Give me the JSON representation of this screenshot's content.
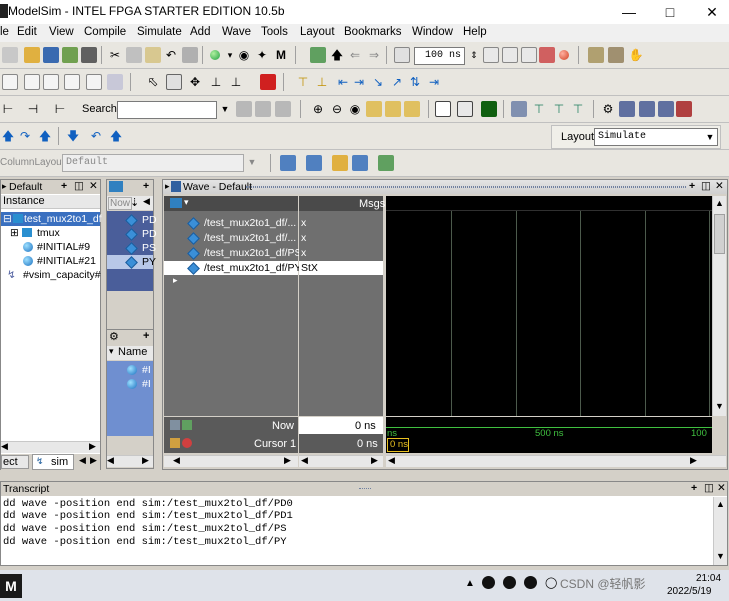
{
  "window": {
    "title": "ModelSim - INTEL FPGA STARTER EDITION 10.5b"
  },
  "menubar": [
    "le",
    "Edit",
    "View",
    "Compile",
    "Simulate",
    "Add",
    "Wave",
    "Tools",
    "Layout",
    "Bookmarks",
    "Window",
    "Help"
  ],
  "toolbar1": {
    "sim_time_value": "100",
    "sim_time_unit": "ns"
  },
  "toolbar3": {
    "search_label": "Search:",
    "search_value": ""
  },
  "toolbar4": {
    "layout_label": "Layout",
    "layout_value": "Simulate"
  },
  "toolbar5": {
    "column_layout_label": "ColumnLayout",
    "column_layout_value": "Default"
  },
  "structure_panel": {
    "title": "Default",
    "column_header": "Instance",
    "items": [
      {
        "label": "test_mux2to1_df"
      },
      {
        "label": "tmux"
      },
      {
        "label": "#INITIAL#9"
      },
      {
        "label": "#INITIAL#21"
      },
      {
        "label": "#vsim_capacity#"
      }
    ],
    "tabs": [
      "ect",
      "sim"
    ]
  },
  "objects_panel": {
    "now_label": "Now",
    "items": [
      "PD",
      "PD",
      "PS",
      "PY"
    ]
  },
  "processes_panel": {
    "column_header": "Name",
    "items": [
      "#I",
      "#I"
    ]
  },
  "wave_panel": {
    "title": "Wave - Default",
    "msgs_header": "Msgs",
    "signals": [
      {
        "name": "/test_mux2to1_df/...",
        "value": "x"
      },
      {
        "name": "/test_mux2to1_df/...",
        "value": "x"
      },
      {
        "name": "/test_mux2to1_df/PS",
        "value": "x"
      },
      {
        "name": "/test_mux2to1_df/PY",
        "value": "StX"
      }
    ],
    "now_label": "Now",
    "now_value": "0 ns",
    "cursor_label": "Cursor 1",
    "cursor_value": "0 ns",
    "cursor_marker": "0 ns",
    "timeline_labels": [
      "ns",
      "500 ns",
      "100"
    ]
  },
  "transcript": {
    "title": "Transcript",
    "lines": [
      "dd wave -position end  sim:/test_mux2tol_df/PD0",
      "dd wave -position end  sim:/test_mux2tol_df/PD1",
      "dd wave -position end  sim:/test_mux2tol_df/PS",
      "dd wave -position end  sim:/test_mux2tol_df/PY"
    ]
  },
  "taskbar": {
    "watermark": "CSDN @轻帆影",
    "time": "21:04",
    "date": "2022/5/19"
  },
  "colors": {
    "wave_bg": "#000000",
    "header_blue": "#3a5a8c",
    "grid": "#4c5a4c",
    "accent_yellow": "#e8c020"
  }
}
